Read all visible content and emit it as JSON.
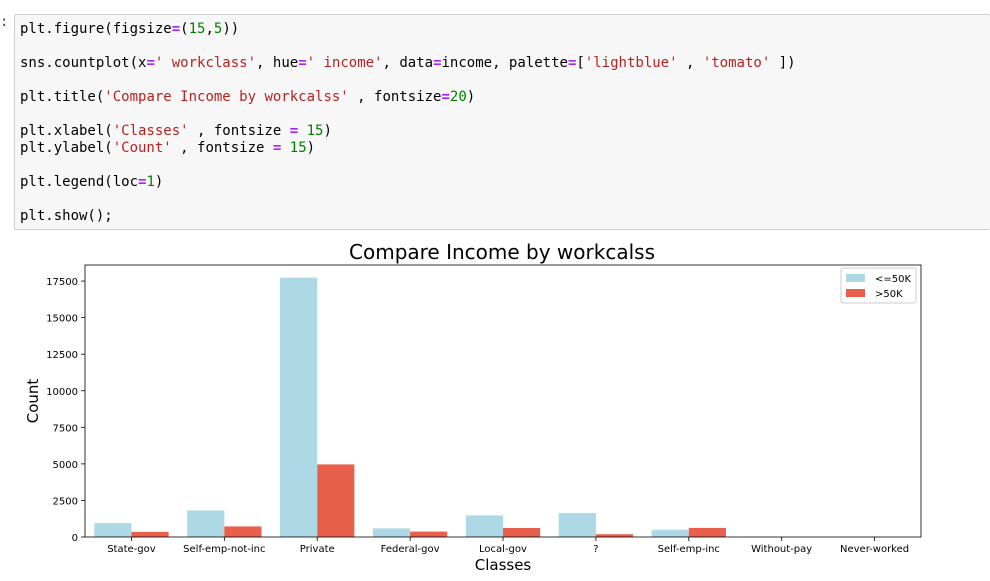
{
  "cell": {
    "prompt": ":",
    "code_lines": [
      [
        {
          "t": "plt.figure(figsize"
        },
        {
          "t": "=",
          "c": "k"
        },
        {
          "t": "("
        },
        {
          "t": "15",
          "c": "n"
        },
        {
          "t": ","
        },
        {
          "t": "5",
          "c": "n"
        },
        {
          "t": "))"
        }
      ],
      [],
      [
        {
          "t": "sns.countplot(x"
        },
        {
          "t": "=",
          "c": "k"
        },
        {
          "t": "' workclass'",
          "c": "s"
        },
        {
          "t": ", hue"
        },
        {
          "t": "=",
          "c": "k"
        },
        {
          "t": "' income'",
          "c": "s"
        },
        {
          "t": ", data"
        },
        {
          "t": "=",
          "c": "k"
        },
        {
          "t": "income, palette"
        },
        {
          "t": "=",
          "c": "k"
        },
        {
          "t": "["
        },
        {
          "t": "'lightblue'",
          "c": "s"
        },
        {
          "t": " , "
        },
        {
          "t": "'tomato'",
          "c": "s"
        },
        {
          "t": " ])"
        }
      ],
      [],
      [
        {
          "t": "plt.title("
        },
        {
          "t": "'Compare Income by workcalss'",
          "c": "s"
        },
        {
          "t": " , fontsize"
        },
        {
          "t": "=",
          "c": "k"
        },
        {
          "t": "20",
          "c": "n"
        },
        {
          "t": ")"
        }
      ],
      [],
      [
        {
          "t": "plt.xlabel("
        },
        {
          "t": "'Classes'",
          "c": "s"
        },
        {
          "t": " , fontsize "
        },
        {
          "t": "=",
          "c": "k"
        },
        {
          "t": " "
        },
        {
          "t": "15",
          "c": "n"
        },
        {
          "t": ")"
        }
      ],
      [
        {
          "t": "plt.ylabel("
        },
        {
          "t": "'Count'",
          "c": "s"
        },
        {
          "t": " , fontsize "
        },
        {
          "t": "=",
          "c": "k"
        },
        {
          "t": " "
        },
        {
          "t": "15",
          "c": "n"
        },
        {
          "t": ")"
        }
      ],
      [],
      [
        {
          "t": "plt.legend(loc"
        },
        {
          "t": "=",
          "c": "k"
        },
        {
          "t": "1",
          "c": "n"
        },
        {
          "t": ")"
        }
      ],
      [],
      [
        {
          "t": "plt.show();"
        }
      ]
    ]
  },
  "chart_data": {
    "type": "bar",
    "title": "Compare Income by workcalss",
    "xlabel": "Classes",
    "ylabel": "Count",
    "categories": [
      "State-gov",
      "Self-emp-not-inc",
      "Private",
      "Federal-gov",
      "Local-gov",
      "?",
      "Self-emp-inc",
      "Without-pay",
      "Never-worked"
    ],
    "series": [
      {
        "name": "<=50K",
        "color": "#add8e6",
        "values": [
          945,
          1817,
          17733,
          589,
          1476,
          1645,
          494,
          14,
          7
        ]
      },
      {
        "name": ">50K",
        "color": "#e8604c",
        "values": [
          353,
          724,
          4963,
          371,
          617,
          191,
          622,
          0,
          0
        ]
      }
    ],
    "ylim": [
      0,
      18600
    ],
    "yticks": [
      0,
      2500,
      5000,
      7500,
      10000,
      12500,
      15000,
      17500
    ],
    "grid": false,
    "legend_position": "top-right"
  }
}
